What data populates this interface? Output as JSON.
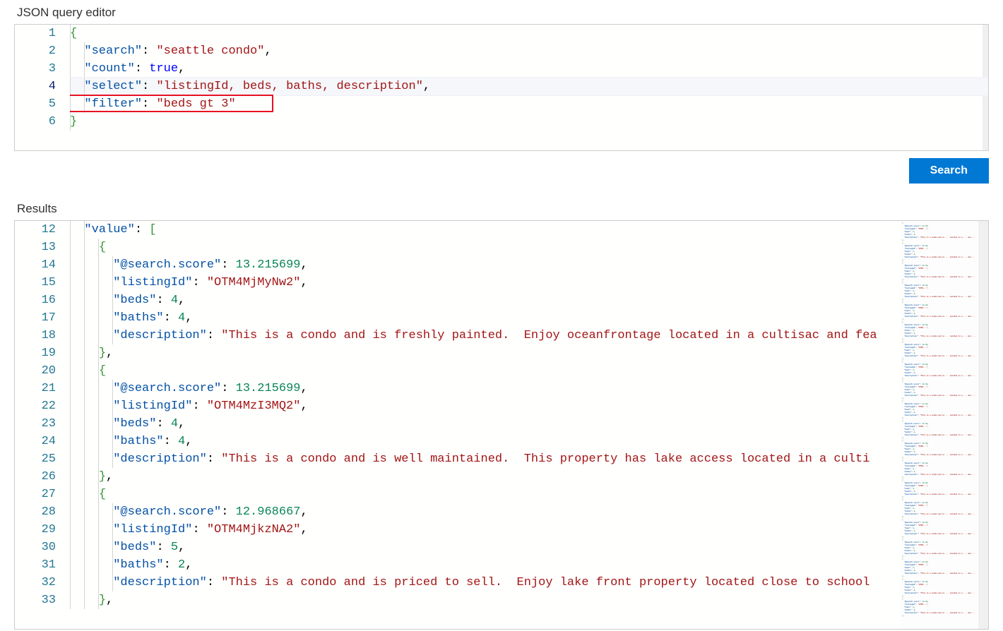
{
  "labels": {
    "editor_title": "JSON query editor",
    "results_title": "Results",
    "search_button": "Search"
  },
  "query": {
    "search": "seattle condo",
    "count": true,
    "select": "listingId, beds, baths, description",
    "filter": "beds gt 3"
  },
  "query_lines": [
    {
      "n": 1,
      "type": "open",
      "text": "{"
    },
    {
      "n": 2,
      "type": "kv_str",
      "key": "search",
      "val": "seattle condo",
      "comma": true
    },
    {
      "n": 3,
      "type": "kv_kw",
      "key": "count",
      "val": "true",
      "comma": true
    },
    {
      "n": 4,
      "type": "kv_str",
      "key": "select",
      "val": "listingId, beds, baths, description",
      "comma": true,
      "current": true
    },
    {
      "n": 5,
      "type": "kv_str",
      "key": "filter",
      "val": "beds gt 3",
      "comma": false,
      "highlight": true
    },
    {
      "n": 6,
      "type": "close",
      "text": "}"
    }
  ],
  "results": {
    "value": [
      {
        "search_score": 13.215699,
        "listingId": "OTM4MjMyNw2",
        "beds": 4,
        "baths": 4,
        "description": "This is a condo and is freshly painted.  Enjoy oceanfrontage located in a cultisac and fea"
      },
      {
        "search_score": 13.215699,
        "listingId": "OTM4MzI3MQ2",
        "beds": 4,
        "baths": 4,
        "description": "This is a condo and is well maintained.  This property has lake access located in a culti"
      },
      {
        "search_score": 12.968667,
        "listingId": "OTM4MjkzNA2",
        "beds": 5,
        "baths": 2,
        "description": "This is a condo and is priced to sell.  Enjoy lake front property located close to school"
      }
    ]
  },
  "results_start_line": 12,
  "colors": {
    "primary": "#0078d4",
    "highlight_border": "#e81123"
  }
}
